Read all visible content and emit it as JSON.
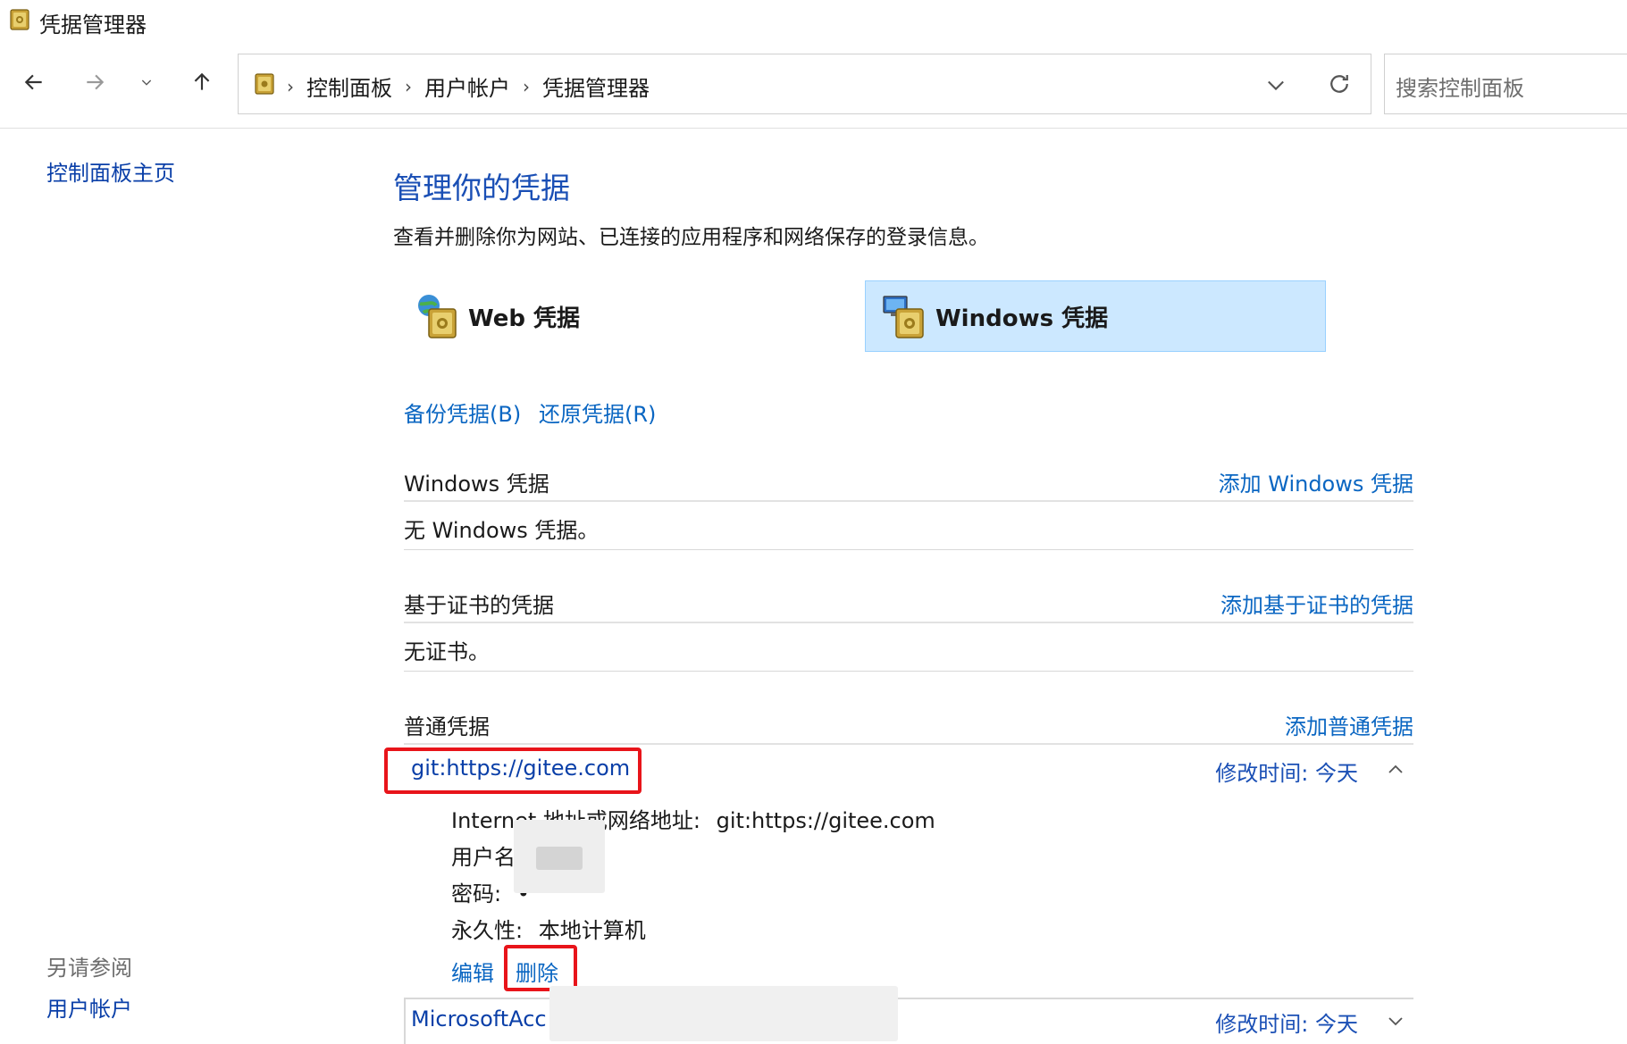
{
  "window": {
    "title": "凭据管理器"
  },
  "nav": {
    "breadcrumbs": [
      "控制面板",
      "用户帐户",
      "凭据管理器"
    ],
    "search_placeholder": "搜索控制面板"
  },
  "left": {
    "home": "控制面板主页",
    "see_also_title": "另请参阅",
    "see_also_link": "用户帐户"
  },
  "main": {
    "heading": "管理你的凭据",
    "description": "查看并删除你为网站、已连接的应用程序和网络保存的登录信息。",
    "tabs": [
      {
        "label": "Web 凭据",
        "selected": false
      },
      {
        "label": "Windows 凭据",
        "selected": true
      }
    ],
    "backup_label": "备份凭据(B)",
    "restore_label": "还原凭据(R)",
    "sections": {
      "windows": {
        "title": "Windows 凭据",
        "add": "添加 Windows 凭据",
        "empty": "无 Windows 凭据。"
      },
      "cert": {
        "title": "基于证书的凭据",
        "add": "添加基于证书的凭据",
        "empty": "无证书。"
      },
      "generic": {
        "title": "普通凭据",
        "add": "添加普通凭据"
      }
    },
    "credentials": [
      {
        "name": "git:https://gitee.com",
        "modified": "修改时间:  今天",
        "expanded": true,
        "address_label": "Internet 地址或网络地址:",
        "address_value": "git:https://gitee.com",
        "username_label": "用户名",
        "password_label": "密码:",
        "password_value": "•",
        "persistence_label": "永久性:",
        "persistence_value": "本地计算机",
        "edit": "编辑",
        "delete": "删除"
      },
      {
        "name": "MicrosoftAcc",
        "modified": "修改时间:  今天",
        "expanded": false
      }
    ]
  },
  "colors": {
    "link": "#0a66c2",
    "heading": "#1a4fb5",
    "selected_tab": "#cce8ff",
    "highlight": "#e8141a"
  }
}
